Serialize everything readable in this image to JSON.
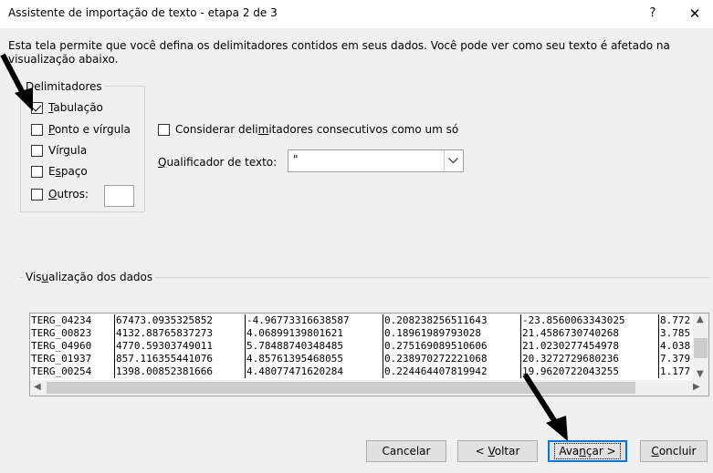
{
  "window": {
    "title": "Assistente de importação de texto - etapa 2 de 3",
    "help": "?",
    "close": "✕"
  },
  "description": "Esta tela permite que você defina os delimitadores contidos em seus dados. Você pode ver como seu texto é afetado na visualização abaixo.",
  "delimiters": {
    "group_label": "Delimitadores",
    "items": [
      {
        "label": "Tabulação",
        "checked": true
      },
      {
        "label": "Ponto e vírgula",
        "checked": false
      },
      {
        "label": "Vírgula",
        "checked": false
      },
      {
        "label": "Espaço",
        "checked": false
      },
      {
        "label": "Outros:",
        "checked": false
      }
    ],
    "outros_value": ""
  },
  "consecutive": {
    "label": "Considerar delimitadores consecutivos como um só",
    "checked": false
  },
  "qualifier": {
    "label": "Qualificador de texto:",
    "value": "\""
  },
  "preview": {
    "group_label": "Visualização dos dados",
    "rows": [
      [
        "TERG_04234",
        "67473.0935325852",
        "-4.96773316638587",
        "0.208238256511643",
        "-23.8560063343025",
        "8.772"
      ],
      [
        "TERG_00823",
        "4132.88765837273",
        "4.06899139801621",
        "0.18961989793028",
        "21.4586730740268",
        "3.785"
      ],
      [
        "TERG_04960",
        "4770.59303749011",
        "5.78488740348485",
        "0.275169089510606",
        "21.0230277454978",
        "4.038"
      ],
      [
        "TERG_01937",
        "857.116355441076",
        "4.85761395468055",
        "0.238970272221068",
        "20.3272729680236",
        "7.379"
      ],
      [
        "TERG_00254",
        "1398.00852381666",
        "4.48077471620284",
        "0.224464407819942",
        "19.9620722043255",
        "1.177"
      ]
    ]
  },
  "buttons": {
    "cancel": "Cancelar",
    "back": "< Voltar",
    "next": "Avançar >",
    "finish": "Concluir"
  }
}
